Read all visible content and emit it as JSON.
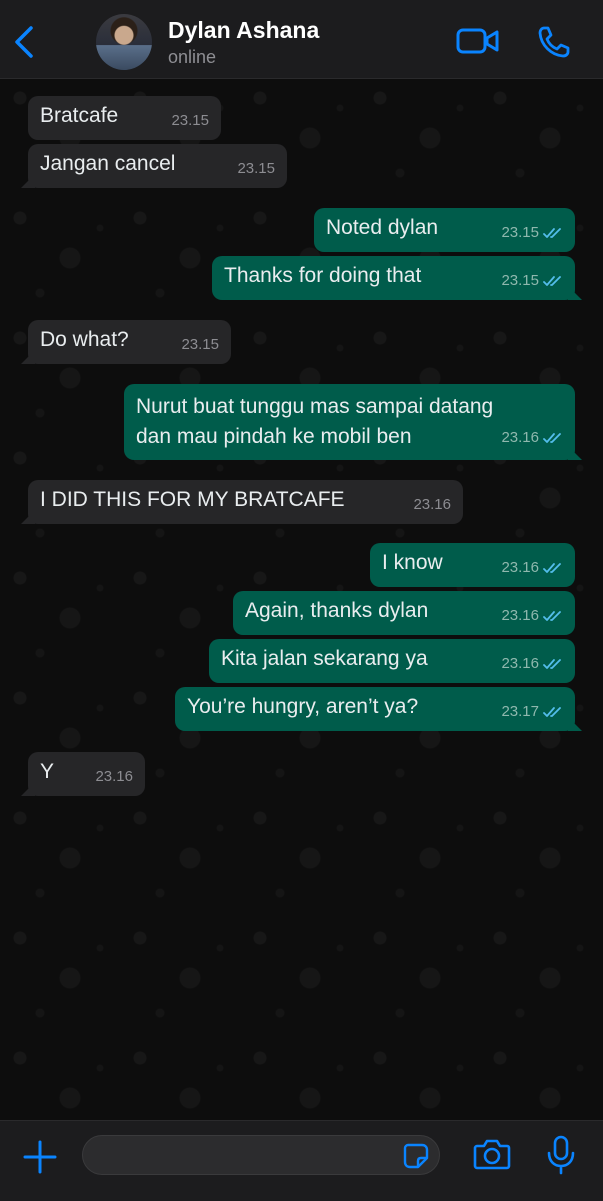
{
  "header": {
    "contact_name": "Dylan Ashana",
    "status": "online",
    "icons": [
      "back-chevron-icon",
      "video-camera-icon",
      "phone-icon"
    ]
  },
  "messages": [
    {
      "dir": "in",
      "text": "Bratcafe",
      "time": "23.15"
    },
    {
      "dir": "in",
      "text": "Jangan cancel",
      "time": "23.15"
    },
    {
      "dir": "out",
      "text": "Noted dylan",
      "time": "23.15",
      "read": true
    },
    {
      "dir": "out",
      "text": "Thanks for doing that",
      "time": "23.15",
      "read": true
    },
    {
      "dir": "in",
      "text": "Do what?",
      "time": "23.15"
    },
    {
      "dir": "out",
      "text": "Nurut buat tunggu mas sampai datang\ndan mau pindah ke mobil ben",
      "time": "23.16",
      "read": true
    },
    {
      "dir": "in",
      "text": "I DID THIS FOR MY BRATCAFE",
      "time": "23.16"
    },
    {
      "dir": "out",
      "text": "I know",
      "time": "23.16",
      "read": true
    },
    {
      "dir": "out",
      "text": "Again, thanks dylan",
      "time": "23.16",
      "read": true
    },
    {
      "dir": "out",
      "text": "Kita jalan sekarang ya",
      "time": "23.16",
      "read": true
    },
    {
      "dir": "out",
      "text": "You’re hungry, aren’t ya?",
      "time": "23.17",
      "read": true
    },
    {
      "dir": "in",
      "text": "Y",
      "time": "23.16"
    }
  ],
  "composer": {
    "placeholder": "",
    "icons": [
      "plus-icon",
      "sticker-icon",
      "camera-icon",
      "microphone-icon"
    ]
  },
  "colors": {
    "accent": "#0a84ff",
    "incoming_bubble": "#262628",
    "outgoing_bubble": "#005c4b",
    "read_ticks": "#53bdeb"
  }
}
